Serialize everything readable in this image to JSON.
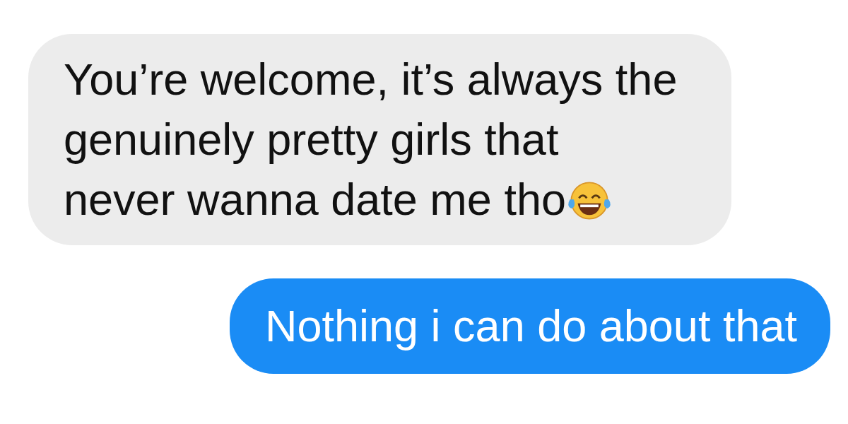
{
  "messages": [
    {
      "kind": "received",
      "text": "You’re welcome, it’s always the\ngenuinely pretty girls that\nnever wanna date me tho",
      "emoji": true
    },
    {
      "kind": "sent",
      "text": "Nothing i can do about that",
      "emoji": false
    }
  ]
}
